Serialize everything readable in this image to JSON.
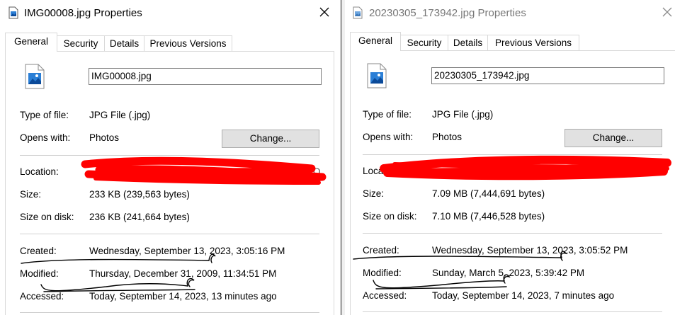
{
  "left": {
    "title": "IMG00008.jpg Properties",
    "tabs": [
      "General",
      "Security",
      "Details",
      "Previous Versions"
    ],
    "filename": "IMG00008.jpg",
    "type_label": "Type of file:",
    "type_value": "JPG File (.jpg)",
    "opens_label": "Opens with:",
    "opens_value": "Photos",
    "change_label": "Change...",
    "location_label": "Location:",
    "location_tail": "O",
    "size_label": "Size:",
    "size_value": "233 KB (239,563 bytes)",
    "disk_label": "Size on disk:",
    "disk_value": "236 KB (241,664 bytes)",
    "created_label": "Created:",
    "created_value": "Wednesday, September 13, 2023, 3:05:16 PM",
    "modified_label": "Modified:",
    "modified_value": "Thursday, December 31, 2009, 11:34:51 PM",
    "accessed_label": "Accessed:",
    "accessed_value": "Today, September 14, 2023, 13 minutes ago"
  },
  "right": {
    "title": "20230305_173942.jpg Properties",
    "tabs": [
      "General",
      "Security",
      "Details",
      "Previous Versions"
    ],
    "filename": "20230305_173942.jpg",
    "type_label": "Type of file:",
    "type_value": "JPG File (.jpg)",
    "opens_label": "Opens with:",
    "opens_value": "Photos",
    "change_label": "Change...",
    "location_label": "Locatio",
    "size_label": "Size:",
    "size_value": "7.09 MB (7,444,691 bytes)",
    "disk_label": "Size on disk:",
    "disk_value": "7.10 MB (7,446,528 bytes)",
    "created_label": "Created:",
    "created_value": "Wednesday, September 13, 2023, 3:05:52 PM",
    "modified_label": "Modified:",
    "modified_value": "Sunday, March 5, 2023, 5:39:42 PM",
    "accessed_label": "Accessed:",
    "accessed_value": "Today, September 14, 2023, 7 minutes ago"
  },
  "colors": {
    "redaction": "#ff0000",
    "scribble": "#000000",
    "photo_icon": "#2b7fd6"
  },
  "icons": [
    "image-file-icon",
    "close-icon",
    "photo-file-icon"
  ]
}
